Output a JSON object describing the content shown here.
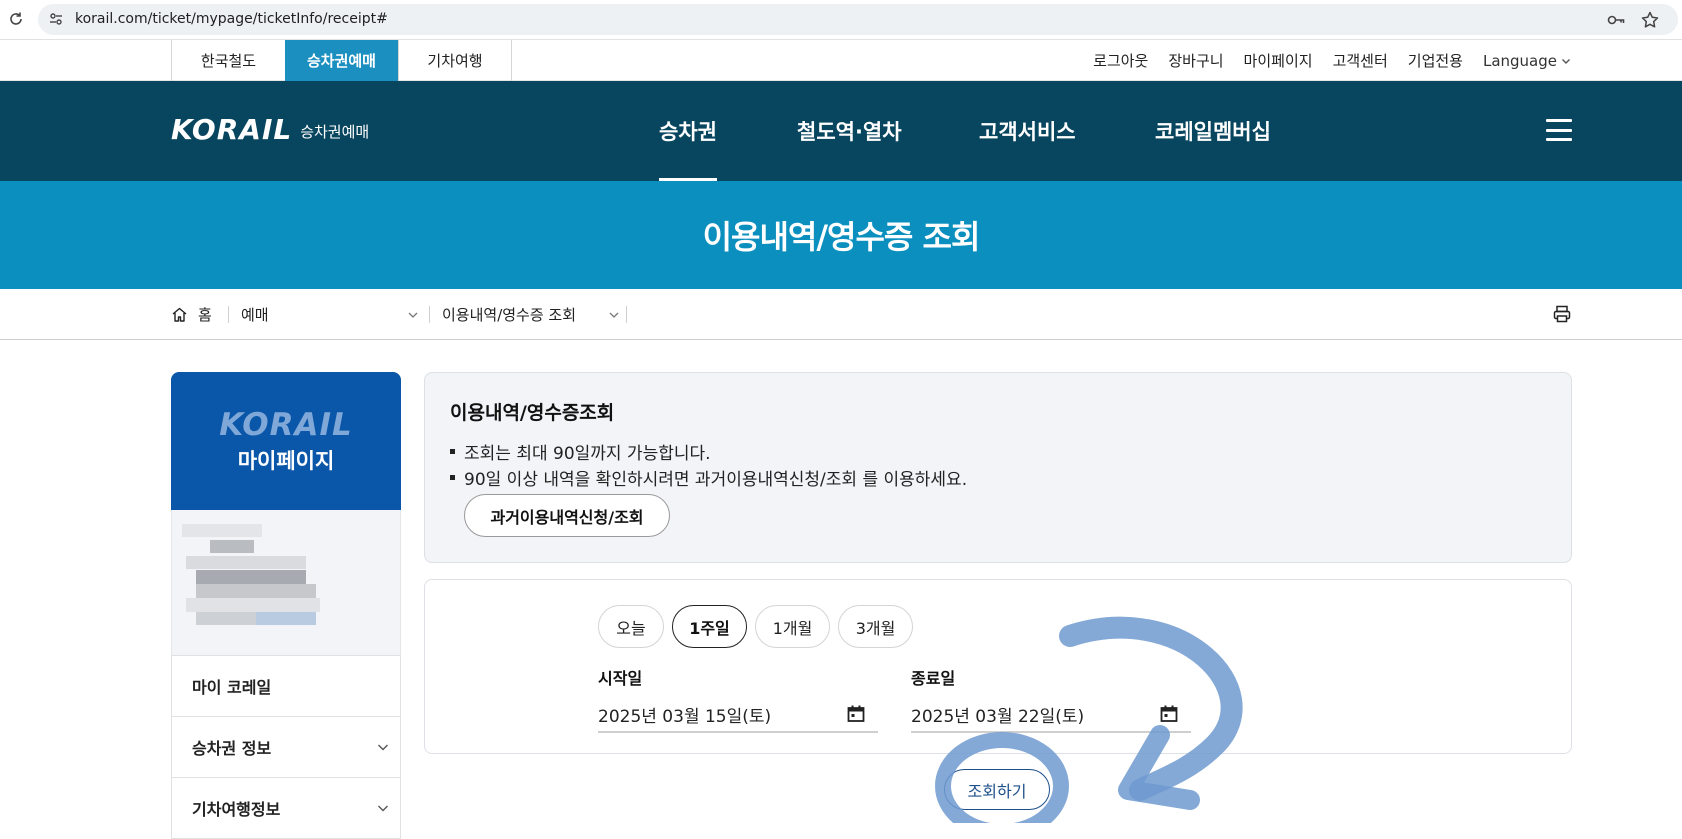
{
  "browser": {
    "url": "korail.com/ticket/mypage/ticketInfo/receipt#",
    "icons": [
      "reload-icon",
      "site-info-icon",
      "key-icon",
      "star-icon"
    ]
  },
  "util_bar": {
    "tabs": [
      "한국철도",
      "승차권예매",
      "기차여행"
    ],
    "active_tab": "승차권예매",
    "links": [
      "로그아웃",
      "장바구니",
      "마이페이지",
      "고객센터",
      "기업전용"
    ],
    "language": "Language"
  },
  "header": {
    "logo": "KORAIL",
    "logo_sub": "승차권예매",
    "nav": [
      "승차권",
      "철도역·열차",
      "고객서비스",
      "코레일멤버십"
    ],
    "active_nav": "승차권"
  },
  "banner": {
    "title": "이용내역/영수증 조회"
  },
  "breadcrumb": {
    "home": "홈",
    "level1": "예매",
    "level2": "이용내역/영수증 조회"
  },
  "sidebar": {
    "logo": "KORAIL",
    "title": "마이페이지",
    "menu": [
      {
        "label": "마이 코레일"
      },
      {
        "label": "승차권 정보"
      },
      {
        "label": "기차여행정보"
      }
    ]
  },
  "info": {
    "title": "이용내역/영수증조회",
    "notes": [
      "조회는 최대 90일까지 가능합니다.",
      "90일 이상 내역을 확인하시려면 과거이용내역신청/조회 를 이용하세요."
    ],
    "past_button": "과거이용내역신청/조회"
  },
  "search": {
    "periods": [
      "오늘",
      "1주일",
      "1개월",
      "3개월"
    ],
    "selected_period": "1주일",
    "start_label": "시작일",
    "start_value": "2025년 03월 15일(토)",
    "end_label": "종료일",
    "end_value": "2025년 03월 22일(토)",
    "submit": "조회하기"
  },
  "colors": {
    "nav_bg": "#08465f",
    "banner_bg": "#0b8fbf",
    "active_tab_bg": "#1a8fc0",
    "sidebar_card_bg": "#0a56a8",
    "annotation": "#6e9ad0"
  }
}
